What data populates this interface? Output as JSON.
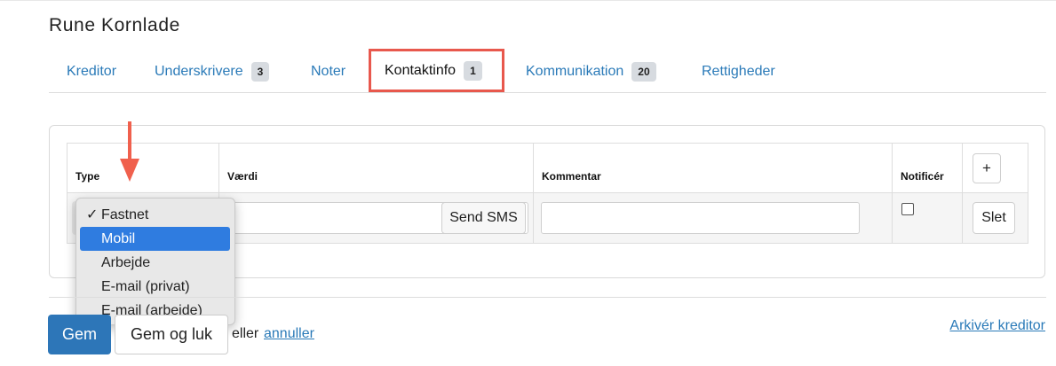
{
  "page": {
    "title": "Rune Kornlade"
  },
  "tabs": [
    {
      "label": "Kreditor"
    },
    {
      "label": "Underskrivere",
      "badge": "3"
    },
    {
      "label": "Noter"
    },
    {
      "label": "Kontaktinfo",
      "badge": "1",
      "active": true
    },
    {
      "label": "Kommunikation",
      "badge": "20"
    },
    {
      "label": "Rettigheder"
    }
  ],
  "table": {
    "headers": {
      "type": "Type",
      "value": "Værdi",
      "comment": "Kommentar",
      "notify": "Notificér",
      "add": "+"
    },
    "row": {
      "send_sms": "Send SMS",
      "delete": "Slet",
      "notify_checked": false
    }
  },
  "dropdown": {
    "checkmark": "✓",
    "options": [
      "Fastnet",
      "Mobil",
      "Arbejde",
      "E-mail (privat)",
      "E-mail (arbejde)"
    ],
    "checked": "Fastnet",
    "highlighted": "Mobil"
  },
  "footer": {
    "save": "Gem",
    "save_close": "Gem og luk",
    "or": "eller",
    "cancel": "annuller",
    "archive": "Arkivér kreditor"
  },
  "colors": {
    "link": "#2a7ab8",
    "primary": "#2d76b8",
    "highlight_border": "#e8584d",
    "selected_option": "#2f7ce0",
    "arrow": "#f0604d"
  },
  "icons": {
    "arrow": "arrow-down-icon",
    "check": "checkmark-icon",
    "add": "plus-icon"
  }
}
